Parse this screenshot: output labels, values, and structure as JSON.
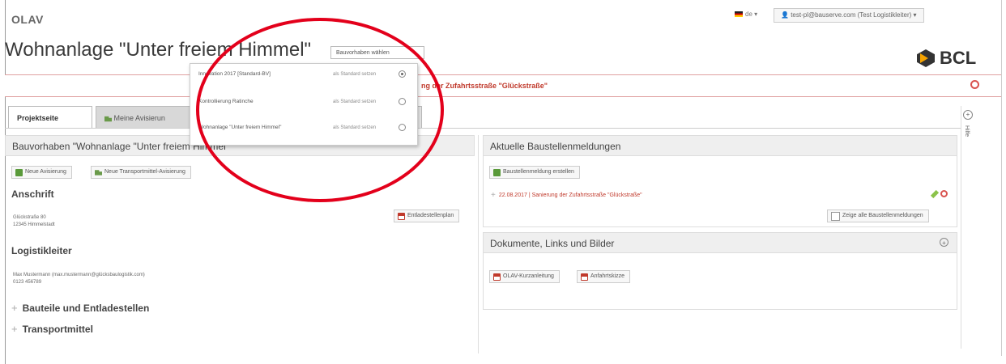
{
  "app": {
    "logo_text": "OLAV"
  },
  "topbar": {
    "language": "de",
    "user": "test-pl@bauserve.com (Test Logistikleiter)"
  },
  "page": {
    "title": "Wohnanlage \"Unter freiem Himmel\"",
    "project_select_label": "Bauvorhaben wählen"
  },
  "brand": {
    "logo_text": "BCL",
    "accent": "#f5a300"
  },
  "alert": {
    "text": "ng der Zufahrtsstraße \"Glückstraße\"",
    "color": "#c0392b"
  },
  "tabs": [
    {
      "label": "Projektseite",
      "active": true
    },
    {
      "label": "Meine Avisierun",
      "active": false
    }
  ],
  "side_panel": {
    "label": "Hilfe"
  },
  "left_panel": {
    "header": "Bauvorhaben \"Wohnanlage \"Unter freiem Himmel\"\"",
    "buttons": {
      "new_avis": "Neue Avisierung",
      "new_transport": "Neue Transportmittel-Avisierung"
    },
    "address": {
      "title": "Anschrift",
      "line1": "Glückstraße 80",
      "line2": "12345 Himmelstadt",
      "plan_button": "Entladestellenplan"
    },
    "logistics": {
      "title": "Logistikleiter",
      "line1": "Max Mustermann (max.mustermann@glücksbaulogistik.com)",
      "line2": "0123 456789"
    },
    "collapsibles": [
      "Bauteile und Entladestellen",
      "Transportmittel"
    ]
  },
  "news_panel": {
    "header": "Aktuelle Baustellenmeldungen",
    "create_button": "Baustellenmeldung erstellen",
    "item": "22.08.2017 | Sanierung der Zufahrtsstraße \"Glückstraße\"",
    "show_all_label": "Zeige alle Baustellenmeldungen"
  },
  "docs_panel": {
    "header": "Dokumente, Links und Bilder",
    "files": [
      "OLAV-Kurzanleitung",
      "Anfahrtskizze"
    ]
  },
  "dropdown": {
    "items": [
      {
        "name": "Innovation 2017 [Standard-BV]",
        "standard_label": "als Standard setzen",
        "selected": true
      },
      {
        "name": "Kontrollierung Ratinche",
        "standard_label": "als Standard setzen",
        "selected": false
      },
      {
        "name": "Wohnanlage \"Unter freiem Himmel\"",
        "standard_label": "als Standard setzen",
        "selected": false
      }
    ]
  },
  "annotation": {
    "color": "#e3001b"
  }
}
